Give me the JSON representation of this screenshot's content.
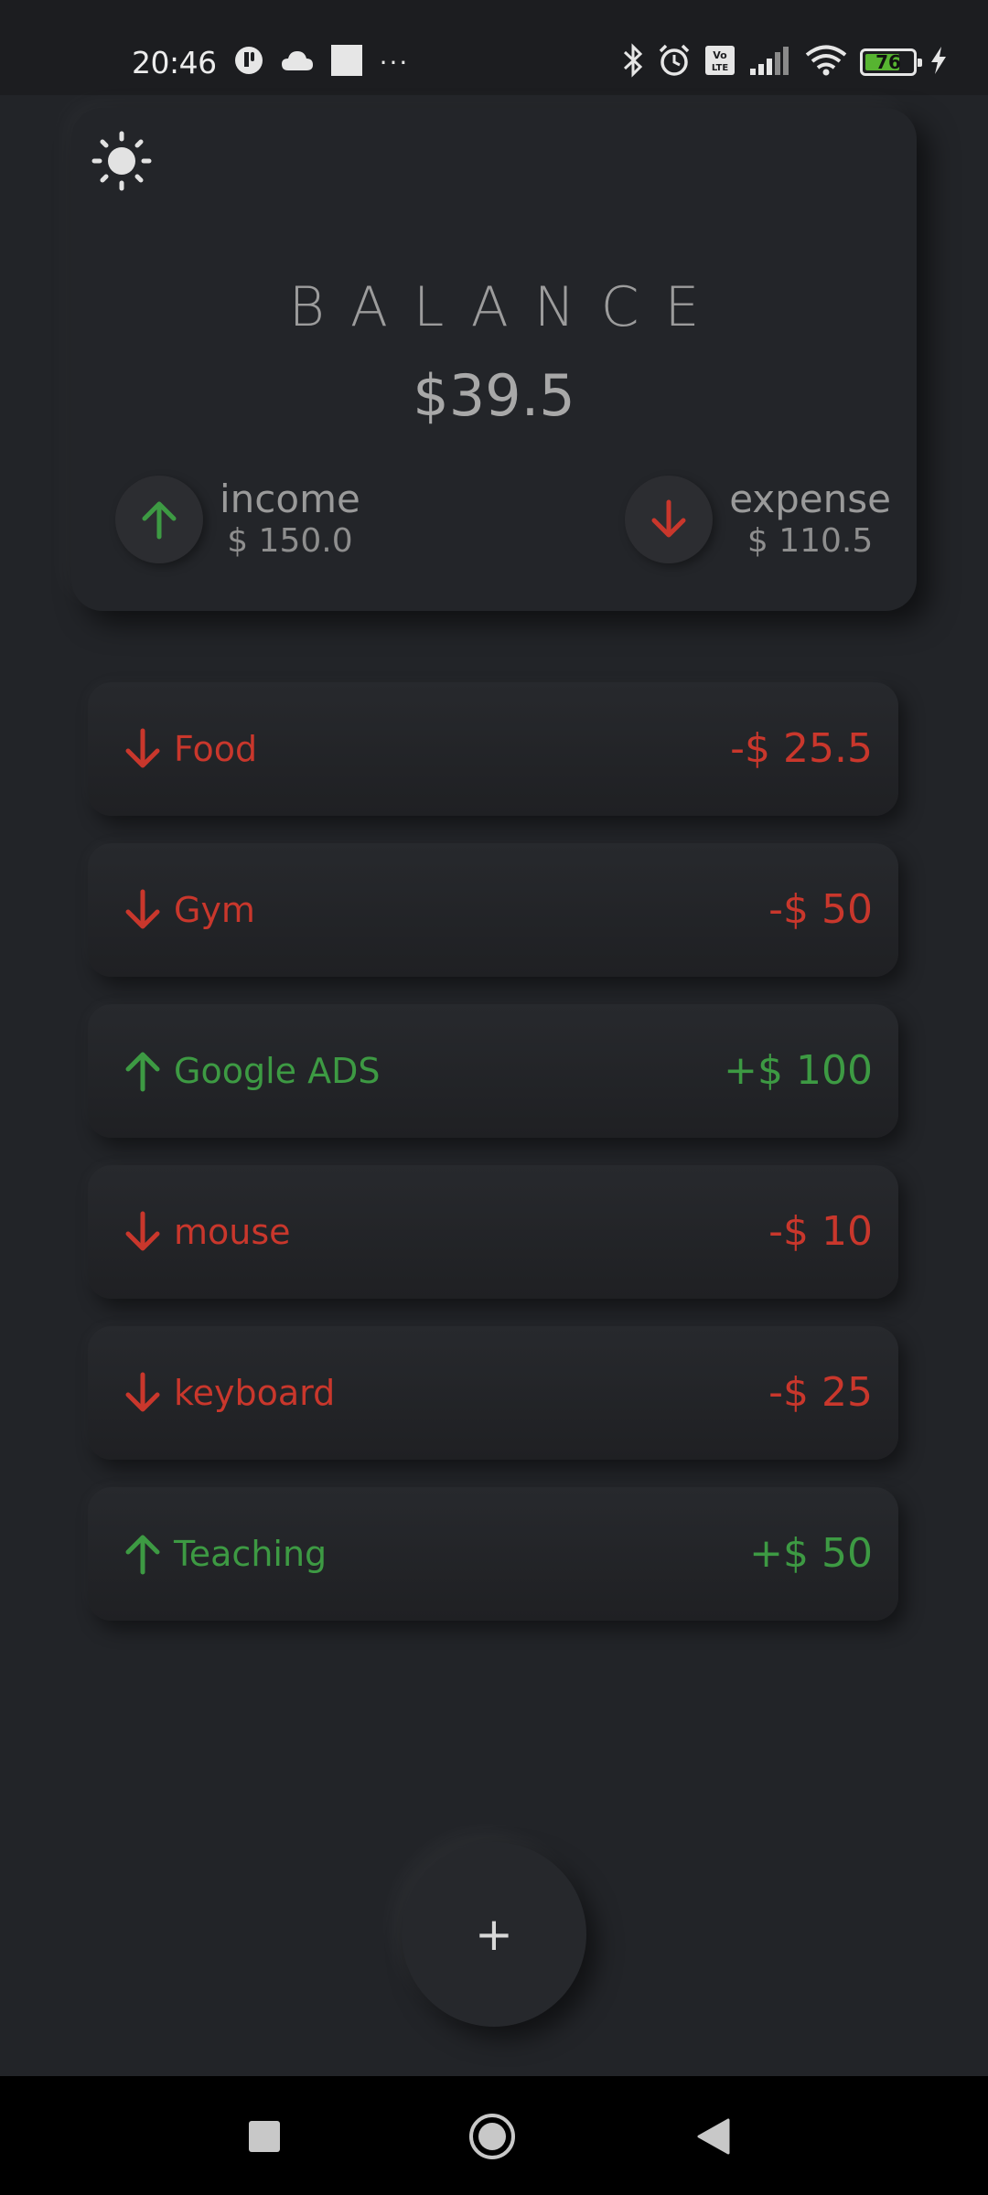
{
  "status_bar": {
    "time": "20:46",
    "more_dots": "···",
    "battery_level": "76",
    "battery_fraction": 0.76
  },
  "icons": {
    "theme": "sun-icon",
    "income": "arrow-up-icon",
    "expense": "arrow-down-icon",
    "fab": "plus-icon"
  },
  "colors": {
    "expense": "#c9372c",
    "income": "#3d9a43",
    "background": "#222428"
  },
  "balance": {
    "heading": "BALANCE",
    "amount": "$39.5",
    "income_label": "income",
    "income_value": "$ 150.0",
    "expense_label": "expense",
    "expense_value": "$ 110.5"
  },
  "transactions": [
    {
      "name": "Food",
      "amount": "-$ 25.5",
      "type": "expense"
    },
    {
      "name": "Gym",
      "amount": "-$ 50",
      "type": "expense"
    },
    {
      "name": "Google ADS",
      "amount": "+$ 100",
      "type": "income"
    },
    {
      "name": "mouse",
      "amount": "-$ 10",
      "type": "expense"
    },
    {
      "name": "keyboard",
      "amount": "-$ 25",
      "type": "expense"
    },
    {
      "name": "Teaching",
      "amount": "+$ 50",
      "type": "income"
    }
  ],
  "fab": {
    "label": "+"
  }
}
